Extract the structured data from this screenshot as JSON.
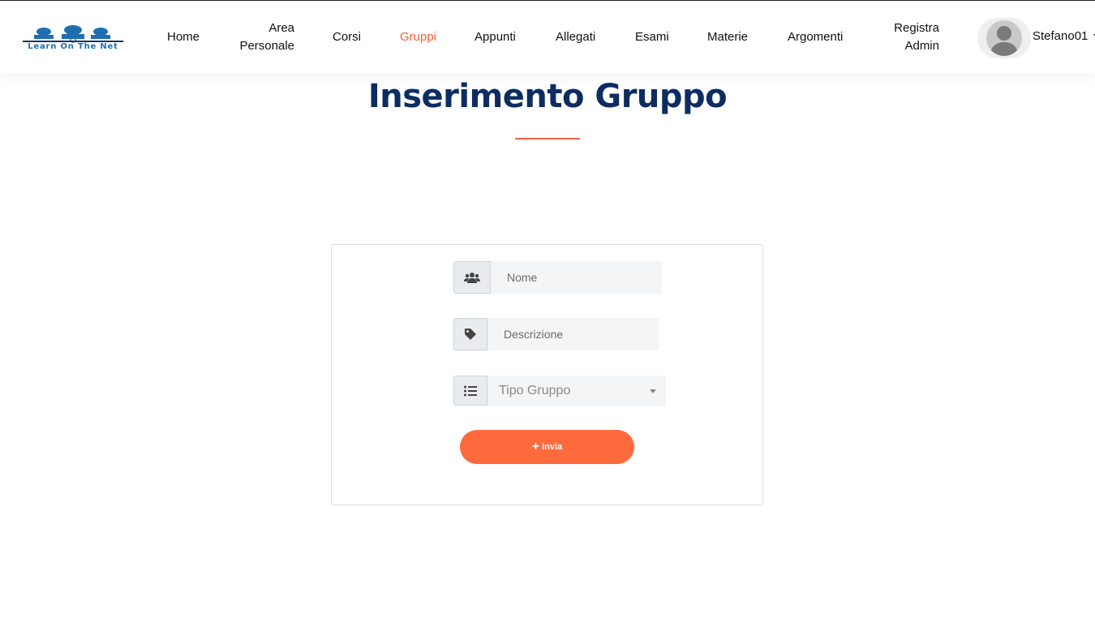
{
  "header": {
    "logo_text": "Learn On The Net",
    "nav": [
      {
        "label": "Home"
      },
      {
        "label": "Area Personale"
      },
      {
        "label": "Corsi"
      },
      {
        "label": "Gruppi",
        "active": true
      },
      {
        "label": "Appunti"
      },
      {
        "label": "Allegati"
      },
      {
        "label": "Esami"
      },
      {
        "label": "Materie"
      },
      {
        "label": "Argomenti"
      },
      {
        "label": "Registra Admin"
      }
    ],
    "user": {
      "name": "Stefano01",
      "avatar_icon": "user-silhouette-icon",
      "dropdown_icon": "caret-down-icon"
    }
  },
  "page": {
    "title": "Inserimento Gruppo"
  },
  "form": {
    "nome": {
      "placeholder": "Nome",
      "icon": "users-icon"
    },
    "descrizione": {
      "placeholder": "Descrizione",
      "icon": "tag-icon"
    },
    "tipo_gruppo": {
      "placeholder": "Tipo Gruppo",
      "icon": "list-icon"
    },
    "submit": {
      "label": "Invia",
      "icon": "plus-icon"
    }
  },
  "colors": {
    "accent": "#ff6a3d",
    "title": "#0d2d62",
    "active_nav": "#f0643a"
  }
}
